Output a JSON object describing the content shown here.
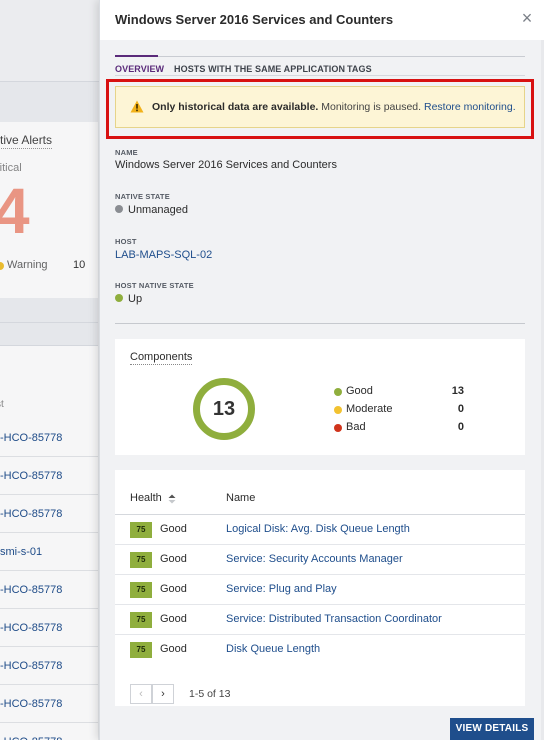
{
  "background": {
    "active_alerts_title": "ctive Alerts",
    "critical_label": "ritical",
    "critical_count": "4",
    "warning_label": "Warning",
    "warning_count": "10",
    "column_header": "st",
    "rows": [
      "-HCO-85778",
      "-HCO-85778",
      "-HCO-85778",
      "smi-s-01",
      "-HCO-85778",
      "-HCO-85778",
      "-HCO-85778",
      "-HCO-85778",
      "-HCO-85778"
    ]
  },
  "panel": {
    "title": "Windows Server 2016 Services and Counters",
    "close_icon": "close-icon",
    "tabs": [
      "OVERVIEW",
      "HOSTS WITH THE SAME APPLICATION",
      "TAGS"
    ],
    "alert": {
      "icon": "warning-triangle-icon",
      "bold_text": "Only historical data are available.",
      "muted_text": "Monitoring is paused.",
      "link_text": "Restore monitoring."
    },
    "fields": {
      "name_label": "NAME",
      "name_value": "Windows Server 2016 Services and Counters",
      "native_state_label": "NATIVE STATE",
      "native_state_value": "Unmanaged",
      "host_label": "HOST",
      "host_value": "LAB-MAPS-SQL-02",
      "host_native_state_label": "HOST NATIVE STATE",
      "host_native_state_value": "Up"
    },
    "components": {
      "title": "Components",
      "total": "13",
      "legend": [
        {
          "label": "Good",
          "count": "13",
          "color": "#8fae3d"
        },
        {
          "label": "Moderate",
          "count": "0",
          "color": "#f2c230"
        },
        {
          "label": "Bad",
          "count": "0",
          "color": "#d0341c"
        }
      ]
    },
    "table": {
      "columns": [
        "Health",
        "Name"
      ],
      "rows": [
        {
          "score": "75",
          "status": "Good",
          "name": "Logical Disk: Avg. Disk Queue Length"
        },
        {
          "score": "75",
          "status": "Good",
          "name": "Service: Security Accounts Manager"
        },
        {
          "score": "75",
          "status": "Good",
          "name": "Service: Plug and Play"
        },
        {
          "score": "75",
          "status": "Good",
          "name": "Service: Distributed Transaction Coordinator"
        },
        {
          "score": "75",
          "status": "Good",
          "name": "Disk Queue Length"
        }
      ],
      "pager_prev": "‹",
      "pager_next": "›",
      "pager_text": "1-5 of 13"
    },
    "view_details_label": "VIEW DETAILS",
    "colors": {
      "accent": "#5a2a7a",
      "link": "#1f4e8c",
      "good": "#8fae3d",
      "unmanaged": "#8a8d92",
      "highlight": "#d81111"
    }
  }
}
